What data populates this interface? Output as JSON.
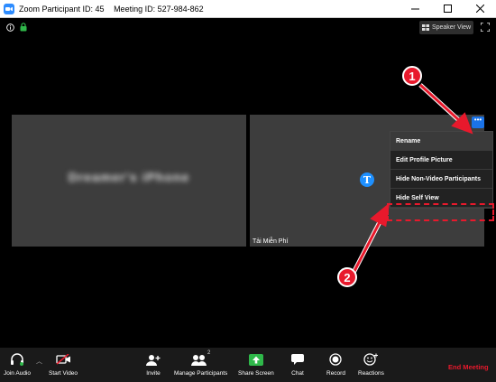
{
  "window": {
    "participant_id": "Zoom Participant ID: 45",
    "meeting_id": "Meeting ID: 527-984-862"
  },
  "header": {
    "speaker_view_label": "Speaker View"
  },
  "tiles": {
    "left_name": "Dreamer's iPhone",
    "right_name": "Tải Miễn Phí",
    "logo_letter": "T"
  },
  "menu": {
    "items": [
      "Rename",
      "Edit Profile Picture",
      "Hide Non-Video Participants",
      "Hide Self View"
    ]
  },
  "annotations": {
    "step1": "1",
    "step2": "2"
  },
  "toolbar": {
    "join_audio": "Join Audio",
    "start_video": "Start Video",
    "invite": "Invite",
    "manage_participants": "Manage Participants",
    "participant_count": "2",
    "share_screen": "Share Screen",
    "chat": "Chat",
    "record": "Record",
    "reactions": "Reactions",
    "end_meeting": "End Meeting"
  },
  "colors": {
    "accent": "#1a73e8",
    "annotation": "#e8192c",
    "share_green": "#2fb84a"
  }
}
